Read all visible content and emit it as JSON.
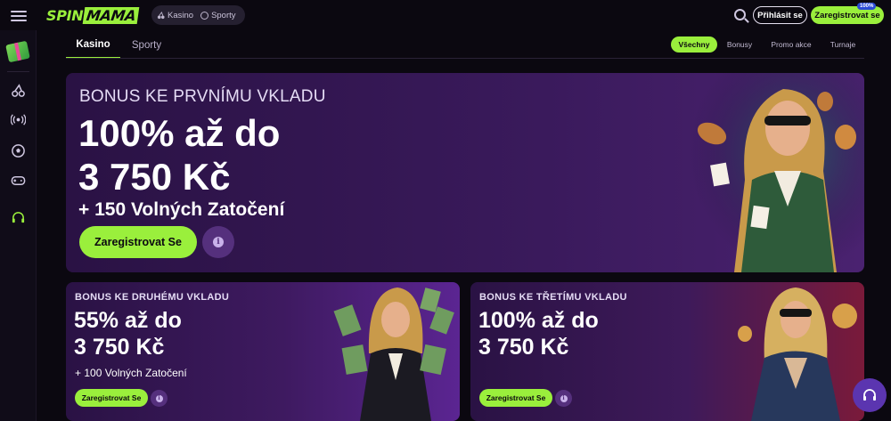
{
  "header": {
    "logo_spin": "SPIN",
    "logo_mama": "MAMA",
    "mode_casino": "Kasino",
    "mode_sports": "Sporty",
    "login_label": "Přihlásit se",
    "register_label": "Zaregistrovat se",
    "register_badge": "100%"
  },
  "tabs": {
    "casino": "Kasino",
    "sports": "Sporty"
  },
  "filters": {
    "all": "Všechny",
    "bonuses": "Bonusy",
    "promos": "Promo akce",
    "tournaments": "Turnaje"
  },
  "main_banner": {
    "subtitle": "BONUS KE PRVNÍMU VKLADU",
    "line1": "100% až do",
    "line2": "3 750 Kč",
    "line3": "+ 150 Volných Zatočení",
    "cta": "Zaregistrovat Se"
  },
  "card_second": {
    "subtitle": "BONUS KE DRUHÉMU VKLADU",
    "line1": "55% až do",
    "line2": "3 750 Kč",
    "line3": "+ 100 Volných Zatočení",
    "cta": "Zaregistrovat Se"
  },
  "card_third": {
    "subtitle": "BONUS KE TŘETÍMU VKLADU",
    "line1": "100% až do",
    "line2": "3 750 Kč",
    "cta": "Zaregistrovat Se"
  },
  "colors": {
    "accent": "#9aef3c",
    "banner_purple": "#3a1a5c",
    "background": "#0b0810"
  }
}
